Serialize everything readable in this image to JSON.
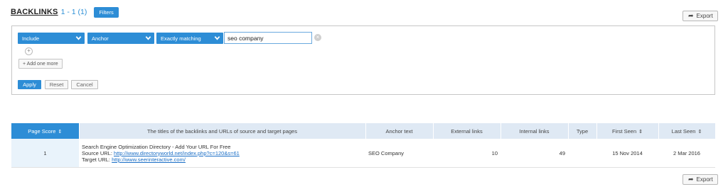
{
  "header": {
    "title": "BACKLINKS",
    "count": "1 - 1 (1)",
    "filters_label": "Filters"
  },
  "export_label": "Export",
  "filter": {
    "include": "Include",
    "field": "Anchor",
    "match": "Exactly matching",
    "value": "seo company",
    "add_more": "+ Add one more",
    "apply": "Apply",
    "reset": "Reset",
    "cancel": "Cancel"
  },
  "table": {
    "columns": [
      "Page Score",
      "The titles of the backlinks and URLs of source and target pages",
      "Anchor text",
      "External links",
      "Internal links",
      "Type",
      "First Seen",
      "Last Seen"
    ],
    "rows": [
      {
        "score": "1",
        "title": "Search Engine Optimization Directory - Add Your URL For Free",
        "source_label": "Source URL:",
        "source_url": "http://www.directoryworld.net/index.php?c=120&s=61",
        "target_label": "Target URL:",
        "target_url": "http://www.seerinteractive.com/",
        "anchor": "SEO Company",
        "external": "10",
        "internal": "49",
        "type": "",
        "first_seen": "15 Nov 2014",
        "last_seen": "2 Mar 2016"
      }
    ]
  },
  "icons": {
    "export": "export-arrow-icon",
    "clear": "clear-icon",
    "sort": "sort-icon",
    "chevron": "chevron-down-icon",
    "add": "add-icon"
  },
  "colors": {
    "accent": "#2d8dd6",
    "header_bg": "#dfe9f4",
    "link": "#1a6ec6"
  }
}
